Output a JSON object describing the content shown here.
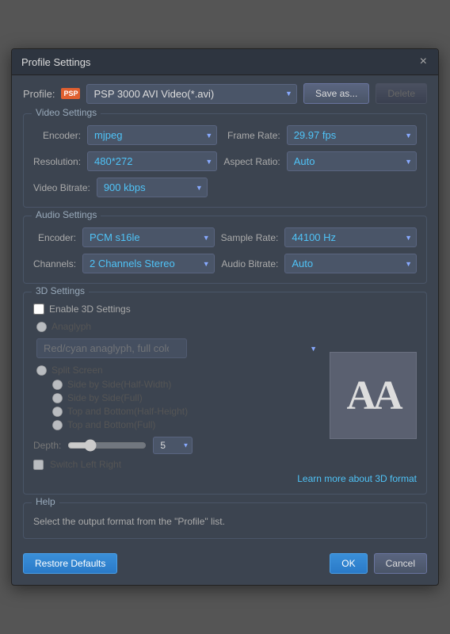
{
  "dialog": {
    "title": "Profile Settings",
    "close_label": "×"
  },
  "profile": {
    "label": "Profile:",
    "icon_text": "PSP",
    "value": "PSP 3000 AVI Video(*.avi)",
    "save_as_label": "Save as...",
    "delete_label": "Delete"
  },
  "video_settings": {
    "section_title": "Video Settings",
    "encoder_label": "Encoder:",
    "encoder_value": "mjpeg",
    "frame_rate_label": "Frame Rate:",
    "frame_rate_value": "29.97 fps",
    "resolution_label": "Resolution:",
    "resolution_value": "480*272",
    "aspect_ratio_label": "Aspect Ratio:",
    "aspect_ratio_value": "Auto",
    "video_bitrate_label": "Video Bitrate:",
    "video_bitrate_value": "900 kbps"
  },
  "audio_settings": {
    "section_title": "Audio Settings",
    "encoder_label": "Encoder:",
    "encoder_value": "PCM s16le",
    "sample_rate_label": "Sample Rate:",
    "sample_rate_value": "44100 Hz",
    "channels_label": "Channels:",
    "channels_value": "2 Channels Stereo",
    "audio_bitrate_label": "Audio Bitrate:",
    "audio_bitrate_value": "Auto"
  },
  "three_d_settings": {
    "section_title": "3D Settings",
    "enable_label": "Enable 3D Settings",
    "anaglyph_label": "Anaglyph",
    "anaglyph_value": "Red/cyan anaglyph, full color",
    "split_screen_label": "Split Screen",
    "side_half_label": "Side by Side(Half-Width)",
    "side_full_label": "Side by Side(Full)",
    "top_half_label": "Top and Bottom(Half-Height)",
    "top_full_label": "Top and Bottom(Full)",
    "depth_label": "Depth:",
    "depth_value": "5",
    "switch_label": "Switch Left Right",
    "learn_more_label": "Learn more about 3D format",
    "preview_text": "AA"
  },
  "help": {
    "section_title": "Help",
    "help_text": "Select the output format from the \"Profile\" list."
  },
  "footer": {
    "restore_defaults_label": "Restore Defaults",
    "ok_label": "OK",
    "cancel_label": "Cancel"
  }
}
